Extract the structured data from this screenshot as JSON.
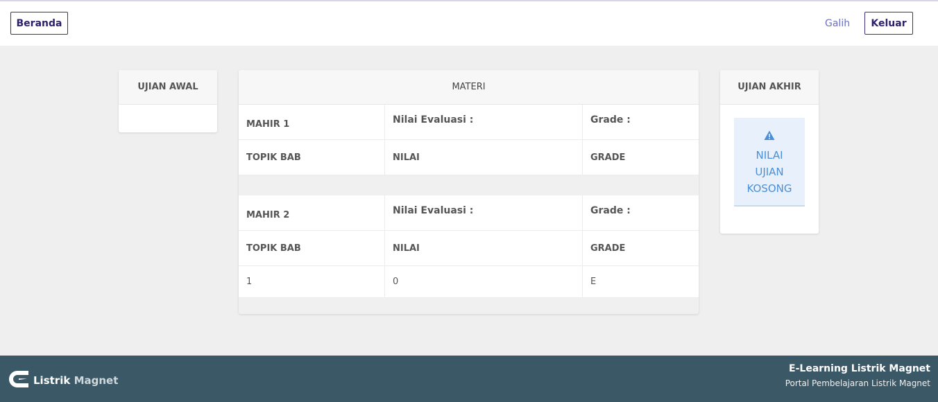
{
  "header": {
    "home_label": "Beranda",
    "user_name": "Galih",
    "logout_label": "Keluar"
  },
  "ujian_awal": {
    "title": "UJIAN AWAL"
  },
  "materi": {
    "title": "MATERI",
    "sections": [
      {
        "name": "MAHIR 1",
        "eval_label": "Nilai Evaluasi :",
        "grade_label": "Grade :",
        "columns": [
          "TOPIK BAB",
          "NILAI",
          "GRADE"
        ],
        "rows": []
      },
      {
        "name": "MAHIR 2",
        "eval_label": "Nilai Evaluasi :",
        "grade_label": "Grade :",
        "columns": [
          "TOPIK BAB",
          "NILAI",
          "GRADE"
        ],
        "rows": [
          [
            "1",
            "0",
            "E"
          ]
        ]
      }
    ]
  },
  "ujian_akhir": {
    "title": "UJIAN AKHIR",
    "alert_icon": "warning-icon",
    "alert_lines": [
      "NILAI",
      "UJIAN",
      "KOSONG"
    ]
  },
  "footer": {
    "logo_text_1": "Listrik",
    "logo_text_2": "Magnet",
    "title": "E-Learning Listrik Magnet",
    "subtitle": "Portal Pembelajaran Listrik Magnet"
  },
  "colors": {
    "accent": "#3d2f7f",
    "link": "#6b6fc4",
    "alert_text": "#4a8fd6",
    "footer_bg": "#3b5866"
  }
}
